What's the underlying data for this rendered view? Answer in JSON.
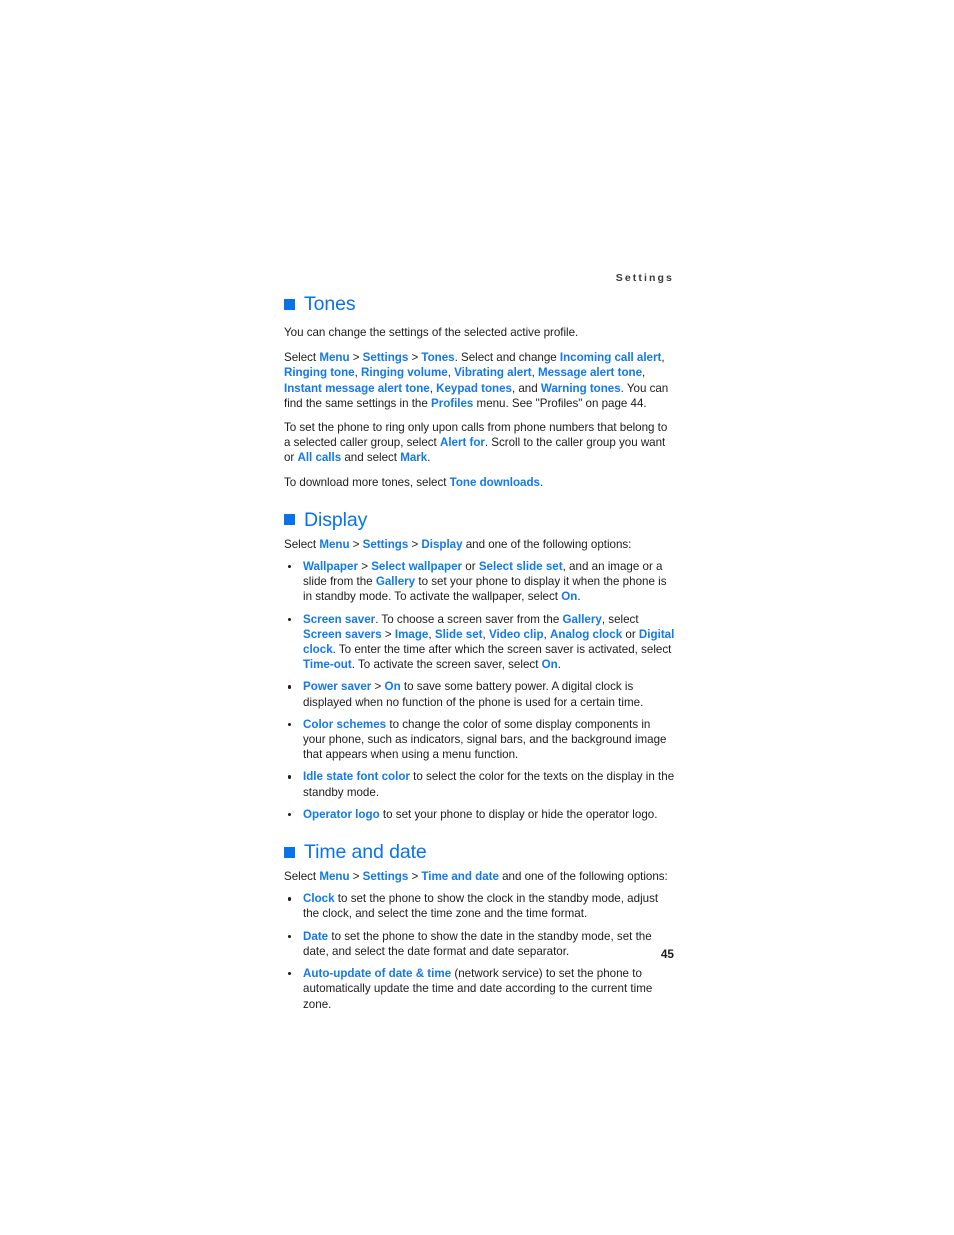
{
  "page": {
    "running_header": "Settings",
    "folio": "45"
  },
  "sections": [
    {
      "id": "tones",
      "heading": "Tones",
      "bullet_icon": "square-bullet",
      "paragraphs": [
        {
          "id": "tones-intro",
          "runs": [
            {
              "t": "You can change the settings of the selected active profile.",
              "s": "plain"
            }
          ]
        },
        {
          "id": "tones-select",
          "runs": [
            {
              "t": "Select ",
              "s": "plain"
            },
            {
              "t": "Menu",
              "s": "link"
            },
            {
              "t": " > ",
              "s": "gt"
            },
            {
              "t": "Settings",
              "s": "link"
            },
            {
              "t": " > ",
              "s": "gt"
            },
            {
              "t": "Tones",
              "s": "link"
            },
            {
              "t": ". Select and change ",
              "s": "plain"
            },
            {
              "t": "Incoming call alert",
              "s": "link"
            },
            {
              "t": ", ",
              "s": "plain"
            },
            {
              "t": "Ringing tone",
              "s": "link"
            },
            {
              "t": ", ",
              "s": "plain"
            },
            {
              "t": "Ringing volume",
              "s": "link"
            },
            {
              "t": ", ",
              "s": "plain"
            },
            {
              "t": "Vibrating alert",
              "s": "link"
            },
            {
              "t": ", ",
              "s": "plain"
            },
            {
              "t": "Message alert tone",
              "s": "link"
            },
            {
              "t": ", ",
              "s": "plain"
            },
            {
              "t": "Instant message alert tone",
              "s": "link"
            },
            {
              "t": ", ",
              "s": "plain"
            },
            {
              "t": "Keypad tones",
              "s": "link"
            },
            {
              "t": ", and ",
              "s": "plain"
            },
            {
              "t": "Warning tones",
              "s": "link"
            },
            {
              "t": ". You can find the same settings in the ",
              "s": "plain"
            },
            {
              "t": "Profiles",
              "s": "link"
            },
            {
              "t": " menu. See \"Profiles\" on page 44.",
              "s": "plain"
            }
          ]
        },
        {
          "id": "tones-callergroup",
          "runs": [
            {
              "t": "To set the phone to ring only upon calls from phone numbers that belong to a selected caller group, select ",
              "s": "plain"
            },
            {
              "t": "Alert for",
              "s": "link"
            },
            {
              "t": ". Scroll to the caller group you want or ",
              "s": "plain"
            },
            {
              "t": "All calls",
              "s": "link"
            },
            {
              "t": " and select ",
              "s": "plain"
            },
            {
              "t": "Mark",
              "s": "link"
            },
            {
              "t": ".",
              "s": "plain"
            }
          ]
        },
        {
          "id": "tones-downloads",
          "runs": [
            {
              "t": "To download more tones, select ",
              "s": "plain"
            },
            {
              "t": "Tone downloads",
              "s": "link"
            },
            {
              "t": ".",
              "s": "plain"
            }
          ]
        }
      ],
      "bullets": []
    },
    {
      "id": "display",
      "heading": "Display",
      "bullet_icon": "square-bullet",
      "paragraphs": [
        {
          "id": "display-select",
          "runs": [
            {
              "t": "Select ",
              "s": "plain"
            },
            {
              "t": "Menu",
              "s": "link"
            },
            {
              "t": " > ",
              "s": "gt"
            },
            {
              "t": "Settings",
              "s": "link"
            },
            {
              "t": " > ",
              "s": "gt"
            },
            {
              "t": "Display",
              "s": "link"
            },
            {
              "t": " and one of the following options:",
              "s": "plain"
            }
          ]
        }
      ],
      "bullets": [
        {
          "id": "display-wallpaper",
          "runs": [
            {
              "t": "Wallpaper",
              "s": "link"
            },
            {
              "t": " > ",
              "s": "gt"
            },
            {
              "t": "Select wallpaper",
              "s": "link"
            },
            {
              "t": " or ",
              "s": "plain"
            },
            {
              "t": "Select slide set",
              "s": "link"
            },
            {
              "t": ", and an image or a slide from the ",
              "s": "plain"
            },
            {
              "t": "Gallery",
              "s": "link"
            },
            {
              "t": " to set your phone to display it when the phone is in standby mode. To activate the wallpaper, select ",
              "s": "plain"
            },
            {
              "t": "On",
              "s": "link"
            },
            {
              "t": ".",
              "s": "plain"
            }
          ]
        },
        {
          "id": "display-screensaver",
          "runs": [
            {
              "t": "Screen saver",
              "s": "link"
            },
            {
              "t": ". To choose a screen saver from the ",
              "s": "plain"
            },
            {
              "t": "Gallery",
              "s": "link"
            },
            {
              "t": ", select ",
              "s": "plain"
            },
            {
              "t": "Screen savers",
              "s": "link"
            },
            {
              "t": " > ",
              "s": "gt"
            },
            {
              "t": "Image",
              "s": "link"
            },
            {
              "t": ", ",
              "s": "plain"
            },
            {
              "t": "Slide set",
              "s": "link"
            },
            {
              "t": ", ",
              "s": "plain"
            },
            {
              "t": "Video clip",
              "s": "link"
            },
            {
              "t": ", ",
              "s": "plain"
            },
            {
              "t": "Analog clock",
              "s": "link"
            },
            {
              "t": " or ",
              "s": "plain"
            },
            {
              "t": "Digital clock",
              "s": "link"
            },
            {
              "t": ". To enter the time after which the screen saver is activated, select ",
              "s": "plain"
            },
            {
              "t": "Time-out",
              "s": "link"
            },
            {
              "t": ". To activate the screen saver, select ",
              "s": "plain"
            },
            {
              "t": "On",
              "s": "link"
            },
            {
              "t": ".",
              "s": "plain"
            }
          ]
        },
        {
          "id": "display-powersaver",
          "runs": [
            {
              "t": "Power saver",
              "s": "link"
            },
            {
              "t": " > ",
              "s": "gt"
            },
            {
              "t": "On",
              "s": "link"
            },
            {
              "t": " to save some battery power. A digital clock is displayed when no function of the phone is used for a certain time.",
              "s": "plain"
            }
          ]
        },
        {
          "id": "display-colorschemes",
          "runs": [
            {
              "t": "Color schemes",
              "s": "link"
            },
            {
              "t": " to change the color of some display components in your phone, such as indicators, signal bars, and the background image that appears when using a menu function.",
              "s": "plain"
            }
          ]
        },
        {
          "id": "display-idlefontcolor",
          "runs": [
            {
              "t": "Idle state font color",
              "s": "link"
            },
            {
              "t": " to select the color for the texts on the display in the standby mode.",
              "s": "plain"
            }
          ]
        },
        {
          "id": "display-operatorlogo",
          "runs": [
            {
              "t": "Operator logo",
              "s": "link"
            },
            {
              "t": " to set your phone to display or hide the operator logo.",
              "s": "plain"
            }
          ]
        }
      ]
    },
    {
      "id": "time-and-date",
      "heading": "Time and date",
      "bullet_icon": "square-bullet",
      "paragraphs": [
        {
          "id": "time-select",
          "runs": [
            {
              "t": "Select ",
              "s": "plain"
            },
            {
              "t": "Menu",
              "s": "link"
            },
            {
              "t": " > ",
              "s": "gt"
            },
            {
              "t": "Settings",
              "s": "link"
            },
            {
              "t": " > ",
              "s": "gt"
            },
            {
              "t": "Time and date",
              "s": "link"
            },
            {
              "t": " and one of the following options:",
              "s": "plain"
            }
          ]
        }
      ],
      "bullets": [
        {
          "id": "time-clock",
          "runs": [
            {
              "t": "Clock",
              "s": "link"
            },
            {
              "t": " to set the phone to show the clock in the standby mode, adjust the clock, and select the time zone and the time format.",
              "s": "plain"
            }
          ]
        },
        {
          "id": "time-date",
          "runs": [
            {
              "t": "Date",
              "s": "link"
            },
            {
              "t": " to set the phone to show the date in the standby mode, set the date, and select the date format and date separator.",
              "s": "plain"
            }
          ]
        },
        {
          "id": "time-autoupdate",
          "runs": [
            {
              "t": "Auto-update of date & time",
              "s": "link"
            },
            {
              "t": " (network service) to set the phone to automatically update the time and date according to the current time zone.",
              "s": "plain"
            }
          ]
        }
      ]
    }
  ],
  "colors": {
    "heading_blue": "#0a72e8",
    "link_blue": "#1479e8",
    "body_text": "#1c1c1c",
    "page_background": "#ffffff"
  }
}
